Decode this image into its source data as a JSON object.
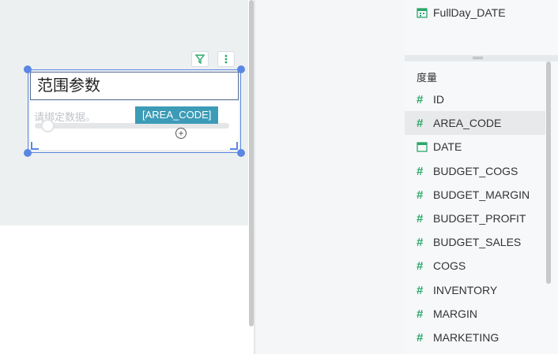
{
  "widget": {
    "title": "范围参数",
    "placeholder": "请绑定数据。",
    "bound_field_tag": "[AREA_CODE]",
    "add_symbol": "+"
  },
  "dimensions": {
    "top_field": {
      "label": "FullDay_DATE",
      "icon": "calendar-icon"
    }
  },
  "measures": {
    "section_label": "度量",
    "items": [
      {
        "label": "ID",
        "icon": "hash-icon"
      },
      {
        "label": "AREA_CODE",
        "icon": "hash-icon"
      },
      {
        "label": "DATE",
        "icon": "calendar-icon"
      },
      {
        "label": "BUDGET_COGS",
        "icon": "hash-icon"
      },
      {
        "label": "BUDGET_MARGIN",
        "icon": "hash-icon"
      },
      {
        "label": "BUDGET_PROFIT",
        "icon": "hash-icon"
      },
      {
        "label": "BUDGET_SALES",
        "icon": "hash-icon"
      },
      {
        "label": "COGS",
        "icon": "hash-icon"
      },
      {
        "label": "INVENTORY",
        "icon": "hash-icon"
      },
      {
        "label": "MARGIN",
        "icon": "hash-icon"
      },
      {
        "label": "MARKETING",
        "icon": "hash-icon"
      }
    ],
    "hash_symbol": "#"
  },
  "colors": {
    "accent": "#5b87e3",
    "tag": "#3c9bb6",
    "measure_icon": "#2aa869"
  }
}
